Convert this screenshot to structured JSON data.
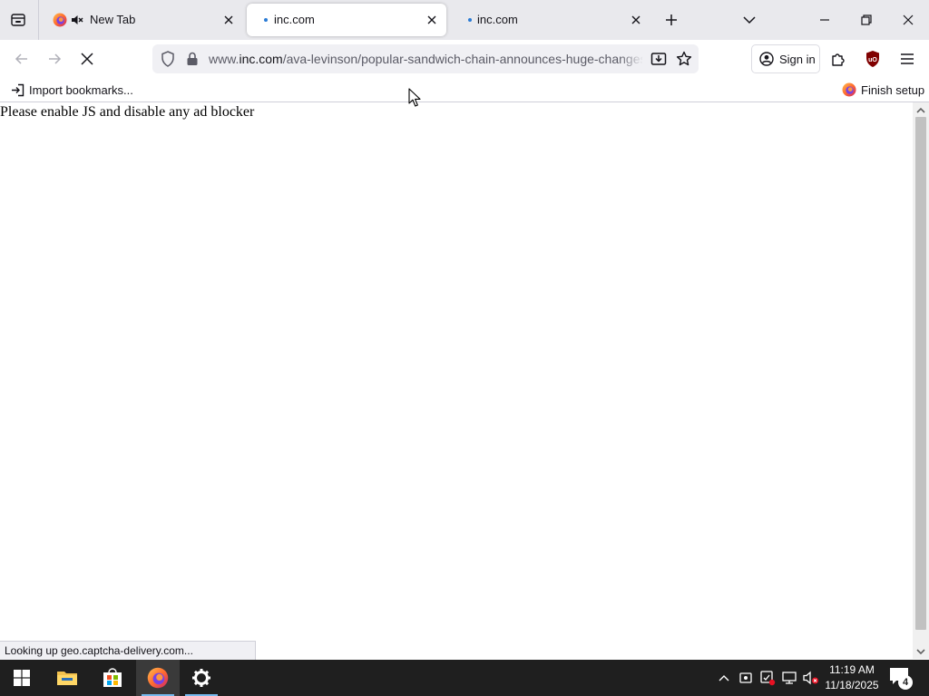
{
  "browser": {
    "tabs": [
      {
        "title": "New Tab",
        "muted": true,
        "active": false
      },
      {
        "title": "inc.com",
        "loading": true,
        "active": true
      },
      {
        "title": "inc.com",
        "loading": true,
        "active": false
      }
    ],
    "url": {
      "prefix": "www.",
      "host": "inc.com",
      "path": "/ava-levinson/popular-sandwich-chain-announces-huge-changes"
    },
    "signin_label": "Sign in",
    "bookmarks": {
      "import_label": "Import bookmarks...",
      "finish_setup_label": "Finish setup"
    },
    "accent_color": "#0060df"
  },
  "page": {
    "message": "Please enable JS and disable any ad blocker",
    "status_text": "Looking up geo.captcha-delivery.com..."
  },
  "taskbar": {
    "time": "11:19 AM",
    "date": "11/18/2025",
    "notification_count": "4"
  }
}
